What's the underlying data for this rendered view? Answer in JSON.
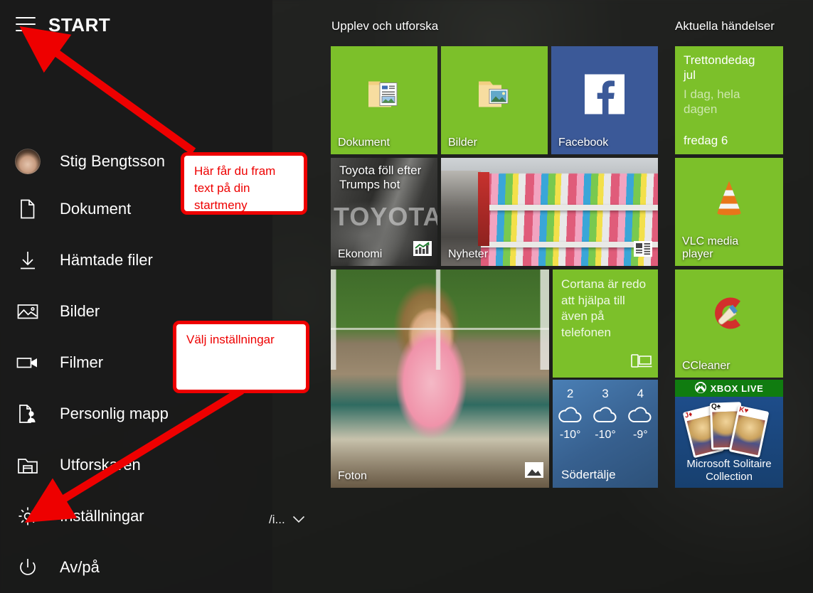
{
  "window": {
    "title": "START",
    "hamburger_icon": "hamburger-menu-icon"
  },
  "sidebar": {
    "user": {
      "name": "Stig Bengtsson",
      "avatar_icon": "user-avatar"
    },
    "items": [
      {
        "label": "Dokument",
        "icon": "document-icon"
      },
      {
        "label": "Hämtade filer",
        "icon": "download-icon"
      },
      {
        "label": "Bilder",
        "icon": "picture-icon"
      },
      {
        "label": "Filmer",
        "icon": "video-camera-icon"
      },
      {
        "label": "Personlig mapp",
        "icon": "personal-folder-icon"
      },
      {
        "label": "Utforskaren",
        "icon": "file-explorer-icon"
      },
      {
        "label": "Inställningar",
        "icon": "gear-icon"
      },
      {
        "label": "Av/på",
        "icon": "power-icon"
      }
    ]
  },
  "bottom_partial": {
    "label": "/i...",
    "chevron_icon": "chevron-down-icon"
  },
  "tile_groups": [
    {
      "heading": "Upplev och utforska"
    },
    {
      "heading": "Aktuella händelser"
    }
  ],
  "tiles": {
    "dokument": {
      "label": "Dokument",
      "icon": "documents-folder-icon",
      "color": "#7cc02a"
    },
    "bilder": {
      "label": "Bilder",
      "icon": "pictures-folder-icon",
      "color": "#7cc02a"
    },
    "facebook": {
      "label": "Facebook",
      "icon": "facebook-icon",
      "color": "#3b5998"
    },
    "ekonomi": {
      "label": "Ekonomi",
      "headline": "Toyota föll efter Trumps hot",
      "watermark": "TOYOTA",
      "corner_icon": "finance-chart-icon"
    },
    "nyheter": {
      "label": "Nyheter",
      "corner_icon": "news-icon"
    },
    "foton": {
      "label": "Foton",
      "corner_icon": "photos-icon"
    },
    "cortana": {
      "text": "Cortana är redo att hjälpa till även på telefonen",
      "corner_icon": "phone-pc-icon",
      "color": "#7cc02a"
    },
    "weather": {
      "city": "Södertälje",
      "days": [
        {
          "day": "2",
          "icon": "cloudy-icon",
          "temp": "-10°"
        },
        {
          "day": "3",
          "icon": "cloudy-icon",
          "temp": "-10°"
        },
        {
          "day": "4",
          "icon": "cloudy-icon",
          "temp": "-9°"
        }
      ]
    },
    "calendar": {
      "title": "Trettondedag jul",
      "when": "I dag, hela dagen",
      "day": "fredag 6",
      "color": "#7cc02a"
    },
    "vlc": {
      "label": "VLC media player",
      "icon": "vlc-cone-icon",
      "color": "#7cc02a"
    },
    "ccleaner": {
      "label": "CCleaner",
      "icon": "ccleaner-icon",
      "color": "#7cc02a"
    },
    "solitaire": {
      "badge": "XBOX LIVE",
      "badge_icon": "xbox-icon",
      "label": "Microsoft Solitaire Collection"
    }
  },
  "annotations": [
    {
      "text": "Här får du fram text på din startmeny",
      "color": "#ee0000"
    },
    {
      "text": "Välj inställningar",
      "color": "#ee0000"
    }
  ]
}
